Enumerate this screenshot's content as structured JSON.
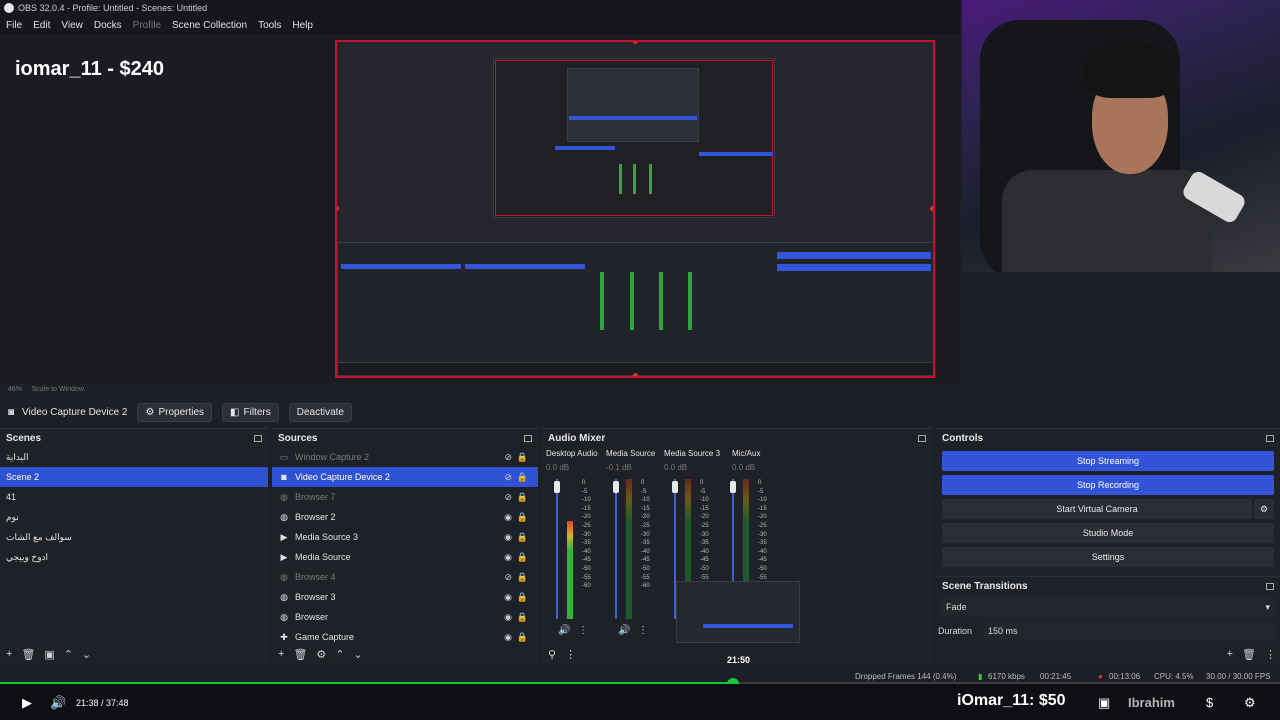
{
  "titlebar": {
    "text": "OBS 32.0.4 - Profile: Untitled - Scenes: Untitled"
  },
  "menu": [
    "File",
    "Edit",
    "View",
    "Docks",
    "Profile",
    "Scene Collection",
    "Tools",
    "Help"
  ],
  "overlay": {
    "donation_title": "iomar_11 - $240"
  },
  "preview": {
    "zoom": "46%",
    "scale_mode": "Scale to Window"
  },
  "source_toolbar": {
    "selected_source": "Video Capture Device 2",
    "properties": "Properties",
    "filters": "Filters",
    "deactivate": "Deactivate"
  },
  "scenes": {
    "title": "Scenes",
    "items": [
      "البداية",
      "Scene 2",
      "41",
      "نوم",
      "سوالف مع الشات",
      "ادوخ وييجي"
    ],
    "selected_index": 1
  },
  "sources": {
    "title": "Sources",
    "items": [
      {
        "label": "Window Capture 2",
        "icon": "window-icon",
        "dim": true
      },
      {
        "label": "Video Capture Device 2",
        "icon": "camera-icon",
        "selected": true
      },
      {
        "label": "Browser 7",
        "icon": "globe-icon",
        "dim": true
      },
      {
        "label": "Browser 2",
        "icon": "globe-icon"
      },
      {
        "label": "Media Source 3",
        "icon": "play-icon"
      },
      {
        "label": "Media Source",
        "icon": "play-icon"
      },
      {
        "label": "Browser 4",
        "icon": "globe-icon",
        "dim": true
      },
      {
        "label": "Browser 3",
        "icon": "globe-icon"
      },
      {
        "label": "Browser",
        "icon": "globe-icon"
      },
      {
        "label": "Game Capture",
        "icon": "gamepad-icon"
      }
    ]
  },
  "audio_mixer": {
    "title": "Audio Mixer",
    "channels": [
      {
        "name": "Desktop Audio",
        "db": "0.0 dB",
        "level": 0.7
      },
      {
        "name": "Media Source",
        "db": "-0.1 dB",
        "level": 0.0
      },
      {
        "name": "Media Source 3",
        "db": "0.0 dB",
        "level": 0.0
      },
      {
        "name": "Mic/Aux",
        "db": "0.0 dB",
        "level": 0.0
      }
    ],
    "ticks": [
      "0",
      "-5",
      "-10",
      "-15",
      "-20",
      "-25",
      "-30",
      "-35",
      "-40",
      "-45",
      "-50",
      "-55",
      "-60"
    ]
  },
  "controls": {
    "title": "Controls",
    "stop_streaming": "Stop Streaming",
    "stop_recording": "Stop Recording",
    "start_virtual_camera": "Start Virtual Camera",
    "studio_mode": "Studio Mode",
    "settings": "Settings"
  },
  "scene_transitions": {
    "title": "Scene Transitions",
    "transition": "Fade",
    "duration_label": "Duration",
    "duration_value": "150 ms"
  },
  "status": {
    "dropped_frames": "Dropped Frames 144 (0.4%)",
    "bitrate": "6170 kbps",
    "stream_time": "00:21:45",
    "rec_time": "00:13:06",
    "cpu": "CPU: 4.5%",
    "fps": "30.00 / 30.00 FPS"
  },
  "player": {
    "current": "21:38",
    "total": "37:48",
    "timecode": "21:38 / 37:48",
    "hover_time": "21:50",
    "progress": 0.573,
    "donation": "iOmar_11:  $50",
    "watermark": "Ibrahim"
  },
  "colors": {
    "accent": "#3354d8",
    "preview_border": "#c8102e",
    "progress": "#18c93a"
  }
}
